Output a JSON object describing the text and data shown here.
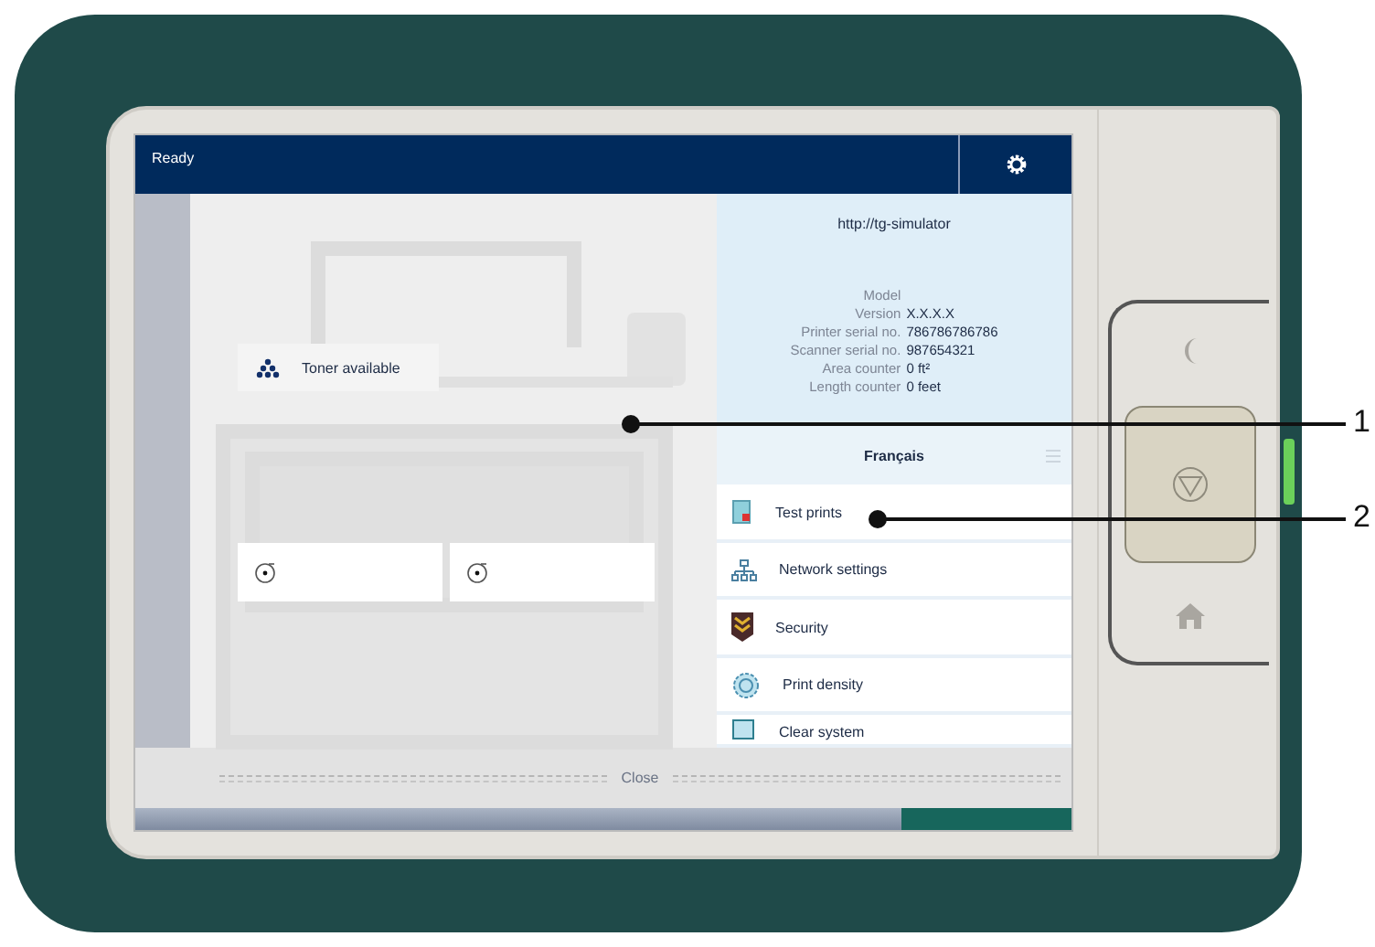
{
  "status_bar": {
    "title": "Ready"
  },
  "printer": {
    "toner": "Toner available"
  },
  "info": {
    "url": "http://tg-simulator",
    "fields": [
      {
        "label": "Model"
      },
      {
        "label": "Version",
        "value": "X.X.X.X"
      },
      {
        "label": "Printer serial no.",
        "value": "786786786786"
      },
      {
        "label": "Scanner serial no.",
        "value": "987654321"
      },
      {
        "label": "Area counter",
        "value": "0 ft²"
      },
      {
        "label": "Length counter",
        "value": "0 feet"
      }
    ]
  },
  "language": "Français",
  "menu": [
    {
      "label": "Test prints"
    },
    {
      "label": "Network settings"
    },
    {
      "label": "Security"
    },
    {
      "label": "Print density"
    },
    {
      "label": "Clear system"
    }
  ],
  "close": "Close",
  "callouts": [
    "1",
    "2"
  ]
}
